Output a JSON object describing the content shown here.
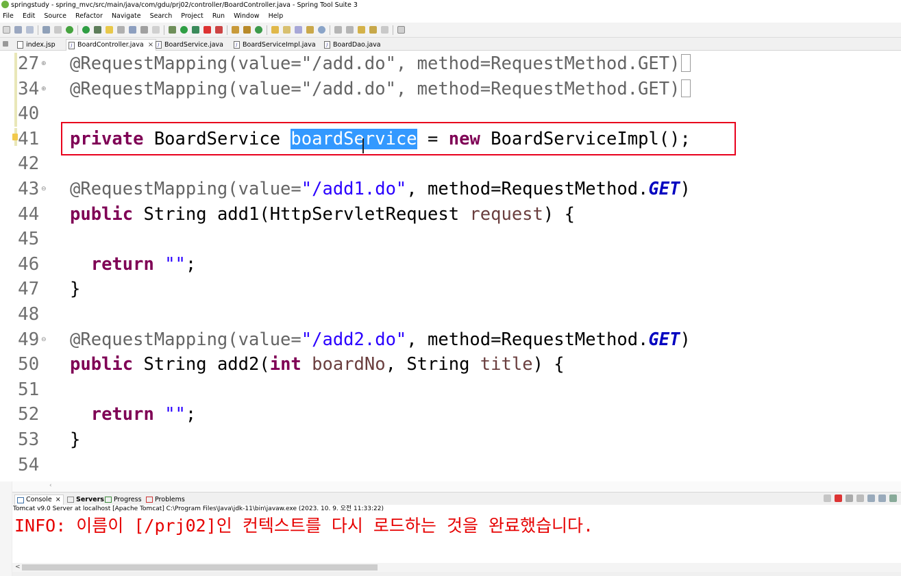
{
  "window": {
    "title": "springstudy - spring_mvc/src/main/java/com/gdu/prj02/controller/BoardController.java - Spring Tool Suite 3"
  },
  "menu": [
    "File",
    "Edit",
    "Source",
    "Refactor",
    "Navigate",
    "Search",
    "Project",
    "Run",
    "Window",
    "Help"
  ],
  "editor_tabs": [
    {
      "label": "index.jsp",
      "active": false
    },
    {
      "label": "BoardController.java",
      "active": true,
      "close": "×"
    },
    {
      "label": "BoardService.java",
      "active": false
    },
    {
      "label": "BoardServiceImpl.java",
      "active": false
    },
    {
      "label": "BoardDao.java",
      "active": false
    }
  ],
  "code": {
    "line_numbers": [
      "27",
      "34",
      "40",
      "41",
      "42",
      "43",
      "44",
      "45",
      "46",
      "47",
      "48",
      "49",
      "50",
      "51",
      "52",
      "53",
      "54"
    ],
    "fold_marker": "⊕",
    "fold_marker_open": "⊖",
    "l27": {
      "ann": "@RequestMapping(value=\"/add.do\", method=RequestMethod.GET)"
    },
    "l34": {
      "ann": "@RequestMapping(value=\"/add.do\", method=RequestMethod.GET)"
    },
    "l41": {
      "private": "private",
      "type": "BoardService",
      "var": "boardService",
      "eq": "=",
      "new": "new",
      "impl": "BoardServiceImpl();"
    },
    "l43": {
      "ann": "@RequestMapping(value=",
      "str": "\"/add1.do\"",
      "mid": ", method=RequestMethod.",
      "get": "GET",
      "close": ")"
    },
    "l44": {
      "public": "public",
      "sig": "String add1(HttpServletRequest",
      "param": "request",
      "end": ") {"
    },
    "l46": {
      "return": "return",
      "str": "\"\"",
      "semi": ";"
    },
    "l47": {
      "brace": "}"
    },
    "l49": {
      "ann": "@RequestMapping(value=",
      "str": "\"/add2.do\"",
      "mid": ", method=RequestMethod.",
      "get": "GET",
      "close": ")"
    },
    "l50": {
      "public": "public",
      "sig1": "String add2(",
      "int": "int",
      "p1": "boardNo",
      "sig2": ", String",
      "p2": "title",
      "end": ") {"
    },
    "l52": {
      "return": "return",
      "str": "\"\"",
      "semi": ";"
    },
    "l53": {
      "brace": "}"
    }
  },
  "console": {
    "tabs": [
      {
        "label": "Console",
        "close": "×",
        "active": true
      },
      {
        "label": "Servers",
        "active": false
      },
      {
        "label": "Progress",
        "active": false
      },
      {
        "label": "Problems",
        "active": false
      }
    ],
    "info": "Tomcat v9.0 Server at localhost [Apache Tomcat] C:\\Program Files\\Java\\jdk-11\\bin\\javaw.exe  (2023. 10. 9. 오전 11:33:22)",
    "output": "INFO: 이름이 [/prj02]인 컨텍스트를 다시 로드하는 것을 완료했습니다."
  },
  "colors": {
    "keyword": "#7f0055",
    "string": "#2a00ff",
    "annotation": "#646464",
    "static_field": "#0000c0",
    "selection": "#3399ff",
    "highlight_box": "#e8001c",
    "console_error": "#e60000"
  }
}
